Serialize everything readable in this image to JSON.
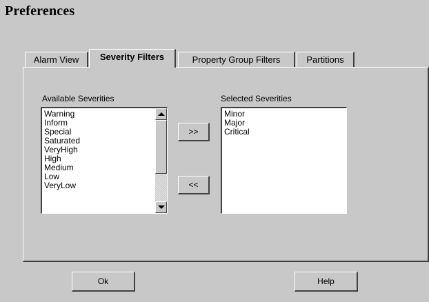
{
  "window": {
    "title": "Preferences"
  },
  "tabs": [
    {
      "label": "Alarm View"
    },
    {
      "label": "Severity Filters"
    },
    {
      "label": "Property Group Filters"
    },
    {
      "label": "Partitions"
    }
  ],
  "severity_filters": {
    "available_label": "Available Severities",
    "selected_label": "Selected Severities",
    "available": [
      "Warning",
      "Inform",
      "Special",
      "Saturated",
      "VeryHigh",
      "High",
      "Medium",
      "Low",
      "VeryLow"
    ],
    "selected": [
      "Minor",
      "Major",
      "Critical"
    ],
    "add_label": ">>",
    "remove_label": "<<"
  },
  "footer": {
    "ok_label": "Ok",
    "help_label": "Help"
  },
  "icons": [
    "scroll-up-arrow-icon",
    "scroll-down-arrow-icon"
  ]
}
